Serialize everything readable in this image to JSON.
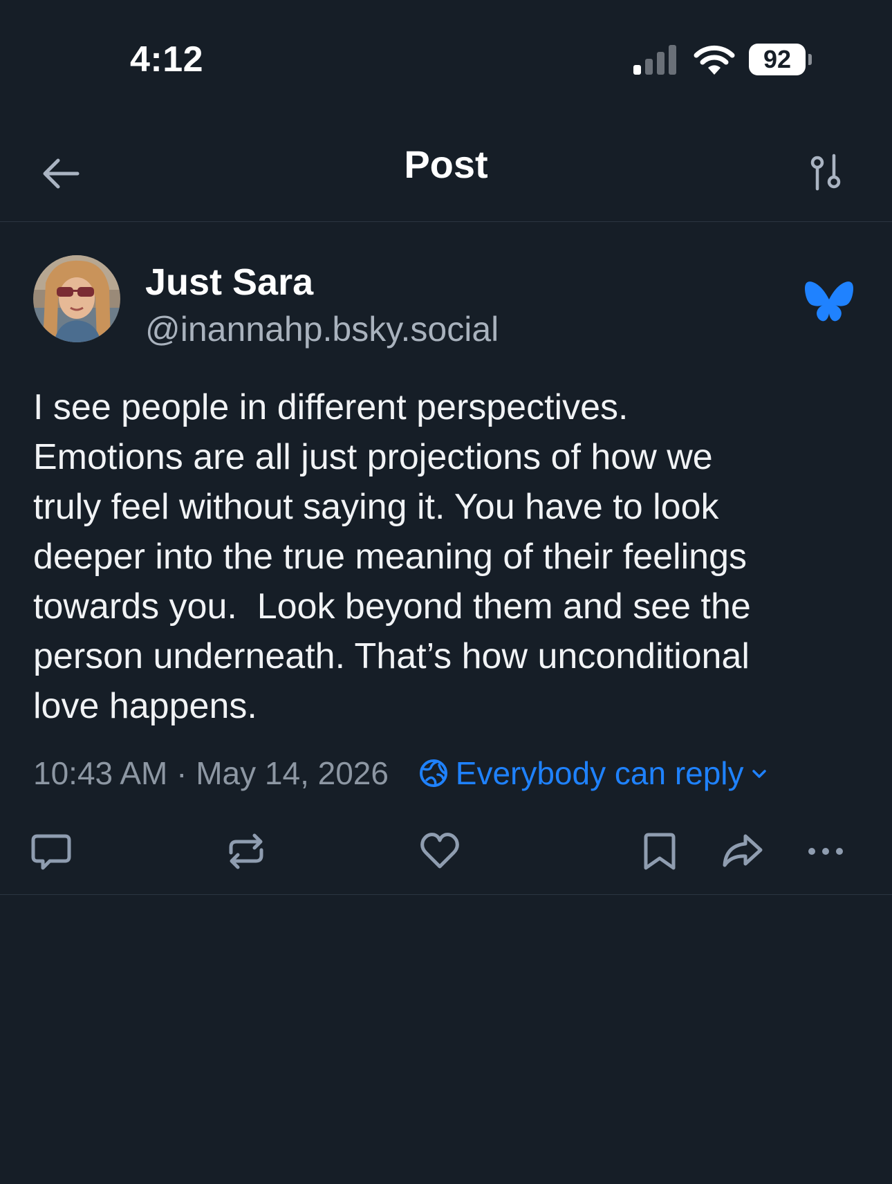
{
  "status_bar": {
    "time": "4:12",
    "battery": "92"
  },
  "header": {
    "title": "Post"
  },
  "post": {
    "author_name": "Just Sara",
    "author_handle": "@inannahp.bsky.social",
    "text": "I see people in different perspectives.\nEmotions are all just projections of how we\ntruly feel without saying it. You have to look\ndeeper into the true meaning of their feelings\ntowards you.  Look beyond them and see the\nperson underneath. That’s how unconditional\nlove happens.",
    "timestamp": "10:43 AM · May 14, 2026",
    "reply_setting": "Everybody can reply"
  },
  "actions": [
    "reply-icon",
    "repost-icon",
    "like-icon",
    "bookmark-icon",
    "share-icon",
    "more-icon"
  ],
  "colors": {
    "background": "#161e27",
    "accent": "#1f82ff",
    "muted_text": "#8d97a3",
    "icon": "#8f9db0",
    "divider": "#2b3541"
  }
}
